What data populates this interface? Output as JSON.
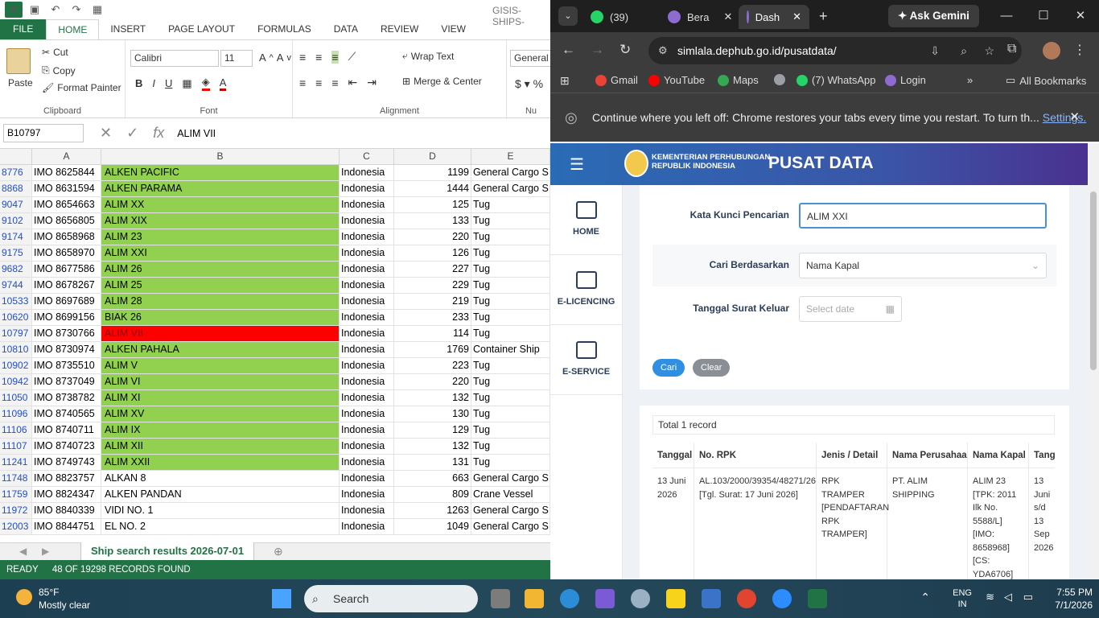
{
  "excel": {
    "doc_title": "GISIS-SHIPS-",
    "tabs": [
      "FILE",
      "HOME",
      "INSERT",
      "PAGE LAYOUT",
      "FORMULAS",
      "DATA",
      "REVIEW",
      "VIEW"
    ],
    "clipboard": {
      "paste": "Paste",
      "cut": "Cut",
      "copy": "Copy",
      "format_painter": "Format Painter",
      "label": "Clipboard"
    },
    "font": {
      "name": "Calibri",
      "size": "11",
      "label": "Font"
    },
    "alignment": {
      "wrap": "Wrap Text",
      "merge": "Merge & Center",
      "label": "Alignment"
    },
    "number": {
      "format": "General",
      "label": "Nu"
    },
    "name_box": "B10797",
    "formula": "ALIM VII",
    "columns": [
      "A",
      "B",
      "C",
      "D",
      "E"
    ],
    "rows": [
      {
        "n": "8776",
        "a": "IMO 8625844",
        "b": "ALKEN PACIFIC",
        "c": "Indonesia",
        "d": "1199",
        "e": "General Cargo S",
        "fill": "green"
      },
      {
        "n": "8868",
        "a": "IMO 8631594",
        "b": "ALKEN PARAMA",
        "c": "Indonesia",
        "d": "1444",
        "e": "General Cargo S",
        "fill": "green"
      },
      {
        "n": "9047",
        "a": "IMO 8654663",
        "b": "ALIM XX",
        "c": "Indonesia",
        "d": "125",
        "e": "Tug",
        "fill": "green"
      },
      {
        "n": "9102",
        "a": "IMO 8656805",
        "b": "ALIM XIX",
        "c": "Indonesia",
        "d": "133",
        "e": "Tug",
        "fill": "green"
      },
      {
        "n": "9174",
        "a": "IMO 8658968",
        "b": "ALIM 23",
        "c": "Indonesia",
        "d": "220",
        "e": "Tug",
        "fill": "green"
      },
      {
        "n": "9175",
        "a": "IMO 8658970",
        "b": "ALIM XXI",
        "c": "Indonesia",
        "d": "126",
        "e": "Tug",
        "fill": "green"
      },
      {
        "n": "9682",
        "a": "IMO 8677586",
        "b": "ALIM 26",
        "c": "Indonesia",
        "d": "227",
        "e": "Tug",
        "fill": "green"
      },
      {
        "n": "9744",
        "a": "IMO 8678267",
        "b": "ALIM 25",
        "c": "Indonesia",
        "d": "229",
        "e": "Tug",
        "fill": "green"
      },
      {
        "n": "10533",
        "a": "IMO 8697689",
        "b": "ALIM 28",
        "c": "Indonesia",
        "d": "219",
        "e": "Tug",
        "fill": "green"
      },
      {
        "n": "10620",
        "a": "IMO 8699156",
        "b": "BIAK 26",
        "c": "Indonesia",
        "d": "233",
        "e": "Tug",
        "fill": "green"
      },
      {
        "n": "10797",
        "a": "IMO 8730766",
        "b": "ALIM VII",
        "c": "Indonesia",
        "d": "114",
        "e": "Tug",
        "fill": "red"
      },
      {
        "n": "10810",
        "a": "IMO 8730974",
        "b": "ALKEN PAHALA",
        "c": "Indonesia",
        "d": "1769",
        "e": "Container Ship",
        "fill": "green"
      },
      {
        "n": "10902",
        "a": "IMO 8735510",
        "b": "ALIM V",
        "c": "Indonesia",
        "d": "223",
        "e": "Tug",
        "fill": "green"
      },
      {
        "n": "10942",
        "a": "IMO 8737049",
        "b": "ALIM VI",
        "c": "Indonesia",
        "d": "220",
        "e": "Tug",
        "fill": "green"
      },
      {
        "n": "11050",
        "a": "IMO 8738782",
        "b": "ALIM XI",
        "c": "Indonesia",
        "d": "132",
        "e": "Tug",
        "fill": "green"
      },
      {
        "n": "11096",
        "a": "IMO 8740565",
        "b": "ALIM XV",
        "c": "Indonesia",
        "d": "130",
        "e": "Tug",
        "fill": "green"
      },
      {
        "n": "11106",
        "a": "IMO 8740711",
        "b": "ALIM IX",
        "c": "Indonesia",
        "d": "129",
        "e": "Tug",
        "fill": "green"
      },
      {
        "n": "11107",
        "a": "IMO 8740723",
        "b": "ALIM XII",
        "c": "Indonesia",
        "d": "132",
        "e": "Tug",
        "fill": "green"
      },
      {
        "n": "11241",
        "a": "IMO 8749743",
        "b": "ALIM XXII",
        "c": "Indonesia",
        "d": "131",
        "e": "Tug",
        "fill": "green"
      },
      {
        "n": "11748",
        "a": "IMO 8823757",
        "b": "ALKAN 8",
        "c": "Indonesia",
        "d": "663",
        "e": "General Cargo S",
        "fill": "none"
      },
      {
        "n": "11759",
        "a": "IMO 8824347",
        "b": "ALKEN PANDAN",
        "c": "Indonesia",
        "d": "809",
        "e": "Crane Vessel",
        "fill": "none"
      },
      {
        "n": "11972",
        "a": "IMO 8840339",
        "b": "VIDI NO. 1",
        "c": "Indonesia",
        "d": "1263",
        "e": "General Cargo S",
        "fill": "none"
      },
      {
        "n": "12003",
        "a": "IMO 8844751",
        "b": "EL NO. 2",
        "c": "Indonesia",
        "d": "1049",
        "e": "General Cargo S",
        "fill": "none"
      }
    ],
    "sheet_tab": "Ship search results 2026-07-01",
    "status_ready": "READY",
    "status_records": "48 OF 19298 RECORDS FOUND"
  },
  "chrome": {
    "tabs": [
      {
        "label": "(39) ",
        "icon": "whatsapp-icon",
        "color": "#25d366"
      },
      {
        "label": "Bera",
        "icon": "globe-icon",
        "color": "#8e6bd1"
      },
      {
        "label": "Dash",
        "icon": "globe-icon",
        "color": "#8e6bd1"
      }
    ],
    "gemini": "Ask Gemini",
    "url": "simlala.dephub.go.id/pusatdata/",
    "bookmarks": [
      {
        "label": "Gmail",
        "color": "#ea4335"
      },
      {
        "label": "YouTube",
        "color": "#ff0000"
      },
      {
        "label": "Maps",
        "color": "#34a853"
      },
      {
        "label": "",
        "color": "#9aa0a6"
      },
      {
        "label": "(7) WhatsApp",
        "color": "#25d366"
      },
      {
        "label": "Login",
        "color": "#8e6bd1"
      }
    ],
    "all_bookmarks": "All Bookmarks",
    "restore_msg": "Continue where you left off: Chrome restores your tabs every time you restart. To turn th...",
    "restore_link": "Settings."
  },
  "site": {
    "ministry_line1": "KEMENTERIAN PERHUBUNGAN",
    "ministry_line2": "REPUBLIK INDONESIA",
    "title": "PUSAT DATA",
    "nav": [
      "HOME",
      "E-LICENCING",
      "E-SERVICE"
    ],
    "form": {
      "keyword_label": "Kata Kunci Pencarian",
      "keyword_value": "ALIM XXI",
      "by_label": "Cari Berdasarkan",
      "by_value": "Nama Kapal",
      "date_label": "Tanggal Surat Keluar",
      "date_placeholder": "Select date",
      "search_btn": "Cari",
      "clear_btn": "Clear"
    },
    "results": {
      "total": "Total 1 record",
      "headers": [
        "Tanggal",
        "No. RPK",
        "Jenis / Detail",
        "Nama Perusahaan",
        "Nama Kapal",
        "Tangga"
      ],
      "row": {
        "tanggal": "13 Juni 2026",
        "rpk": "AL.103/2000/39354/48271/26 [Tgl. Surat: 17 Juni 2026]",
        "jenis": "RPK TRAMPER [PENDAFTARAN RPK TRAMPER]",
        "perusahaan": "PT. ALIM SHIPPING",
        "kapal": "ALIM 23 [TPK: 2011 Ilk No. 5588/L] [IMO: 8658968] [CS: YDA6706]",
        "tangga": "13 Juni s/d 13 Sep 2026"
      }
    }
  },
  "taskbar": {
    "temp": "85°F",
    "weather": "Mostly clear",
    "search": "Search",
    "lang1": "ENG",
    "lang2": "IN",
    "time": "7:55 PM",
    "date": "7/1/2026"
  }
}
